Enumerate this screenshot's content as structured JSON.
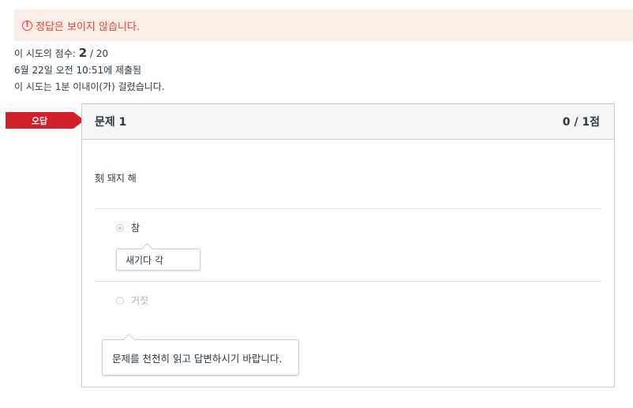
{
  "notice": {
    "icon": "exclamation-circle-icon",
    "icon_glyph": "!",
    "text": "정답은 보이지 않습니다.",
    "color": "#e0463a",
    "background": "#fbeee7"
  },
  "attempt": {
    "score_prefix": "이 시도의 점수: ",
    "score_value": "2",
    "score_suffix": " / 20",
    "submitted": "6월 22일 오전 10:51에 제출됨",
    "duration": "이 시도는 1분 이내이(가) 걸렸습니다."
  },
  "question": {
    "badge": "오답",
    "badge_color": "#d0202a",
    "title": "문제 1",
    "points": "0 / 1점",
    "text": "刻 돼지 해",
    "answers": [
      {
        "label": "참",
        "selected": true,
        "comment": "새기다 각"
      },
      {
        "label": "거짓",
        "selected": false
      }
    ],
    "general_comment": "문제를 천천히 읽고 답변하시기 바랍니다."
  }
}
